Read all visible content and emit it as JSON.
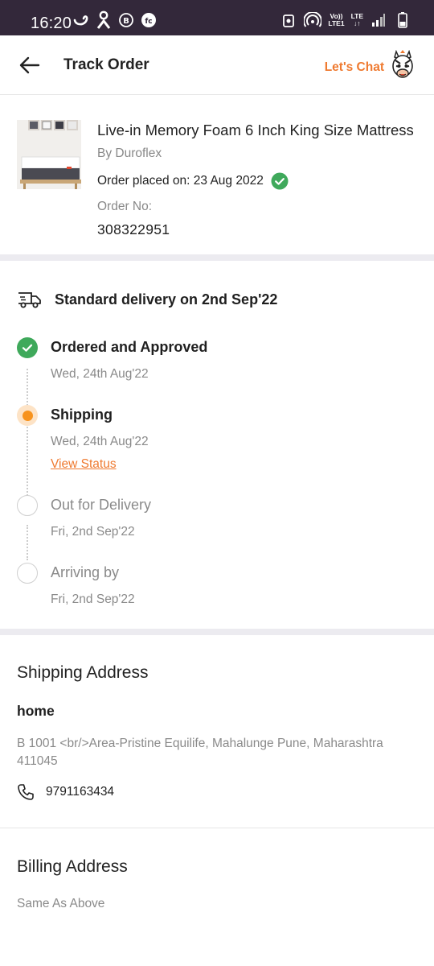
{
  "status_bar": {
    "time": "16:20",
    "lte_top": "Vo))",
    "lte_bottom": "LTE1",
    "lte_right_top": "LTE",
    "lte_right_bottom": "↓↑",
    "left_icons": [
      "swirl-icon",
      "person-icon",
      "b-circle-icon",
      "fc-circle-icon"
    ],
    "right_icons": [
      "alarm-icon",
      "hotspot-icon",
      "signal-icon",
      "battery-icon"
    ]
  },
  "header": {
    "title": "Track Order",
    "chat_label": "Let's Chat",
    "back_icon": "arrow-left-icon",
    "chat_icon": "zebra-mascot-icon"
  },
  "product": {
    "name": "Live-in Memory Foam 6 Inch King Size Mattress",
    "brand": "By Duroflex",
    "order_placed": "Order placed on: 23 Aug 2022",
    "order_no_label": "Order No:",
    "order_no": "308322951"
  },
  "delivery": {
    "title": "Standard delivery on 2nd Sep'22",
    "steps": [
      {
        "title": "Ordered and Approved",
        "date": "Wed, 24th Aug'22",
        "state": "done"
      },
      {
        "title": "Shipping",
        "date": "Wed, 24th Aug'22",
        "state": "active",
        "link": "View Status"
      },
      {
        "title": "Out for Delivery",
        "date": "Fri, 2nd Sep'22",
        "state": "pending"
      },
      {
        "title": "Arriving by",
        "date": "Fri, 2nd Sep'22",
        "state": "pending"
      }
    ]
  },
  "shipping": {
    "title": "Shipping Address",
    "name": "home",
    "address": "B 1001 <br/>Area-Pristine Equilife, Mahalunge Pune, Maharashtra 411045",
    "phone": "9791163434"
  },
  "billing": {
    "title": "Billing Address",
    "text": "Same As Above"
  },
  "colors": {
    "status_bar": "#33283a",
    "accent": "#ef7a30",
    "success": "#3fa95b",
    "active": "#f7931e"
  }
}
